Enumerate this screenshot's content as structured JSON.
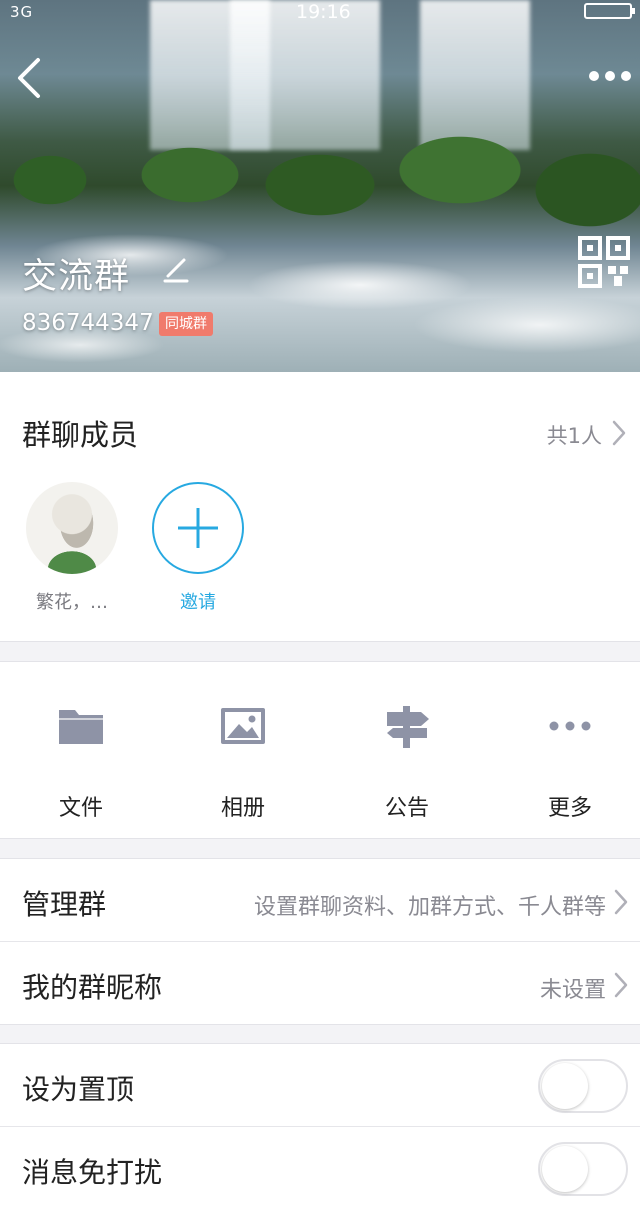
{
  "statusbar": {
    "network": "3G",
    "time": "19:16"
  },
  "header": {
    "group_name": "交流群",
    "group_id": "836744347",
    "badge": "同城群"
  },
  "members": {
    "title": "群聊成员",
    "count": "共1人",
    "list": [
      {
        "name": "繁花，…"
      },
      {
        "name": "邀请"
      }
    ]
  },
  "features": [
    {
      "label": "文件",
      "icon": "folder-icon"
    },
    {
      "label": "相册",
      "icon": "image-icon"
    },
    {
      "label": "公告",
      "icon": "signpost-icon"
    },
    {
      "label": "更多",
      "icon": "more-dots-icon"
    }
  ],
  "settings": [
    {
      "label": "管理群",
      "value": "设置群聊资料、加群方式、千人群等"
    },
    {
      "label": "我的群昵称",
      "value": "未设置"
    }
  ],
  "toggles": [
    {
      "label": "设为置顶",
      "on": false
    },
    {
      "label": "消息免打扰",
      "on": false
    }
  ],
  "colors": {
    "accent": "#27a9e1",
    "badge": "#f07b6c",
    "icon_gray": "#8e93a6"
  }
}
